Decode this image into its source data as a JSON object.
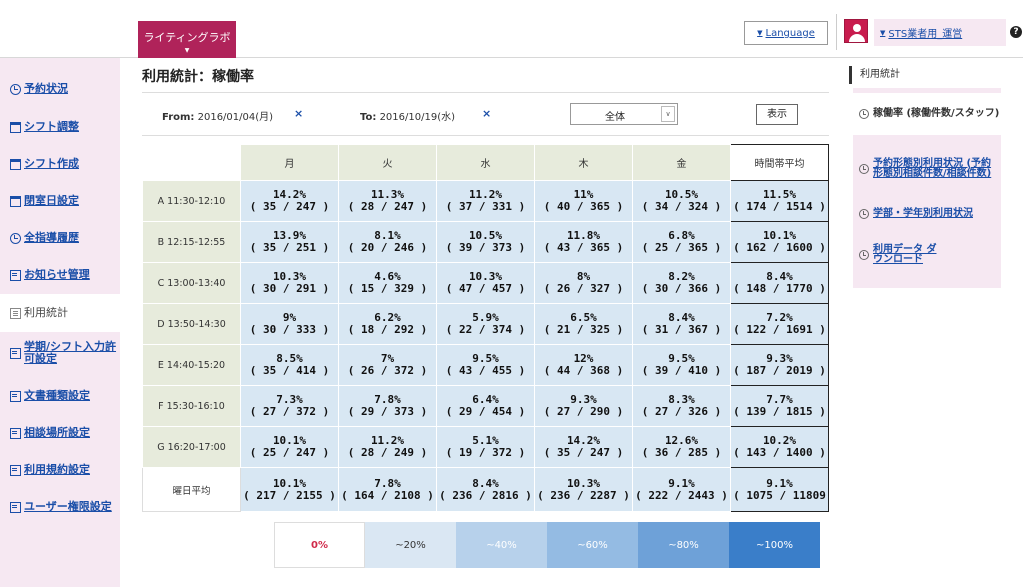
{
  "header": {
    "brand_label": "ライティングラボ",
    "language_label": "Language",
    "user_label": "STS業者用_運営",
    "help_label": "?"
  },
  "sidebar": {
    "items": [
      {
        "label": "予約状況",
        "icon": "clock-icon"
      },
      {
        "label": "シフト調整",
        "icon": "calendar-icon"
      },
      {
        "label": "シフト作成",
        "icon": "calendar-icon"
      },
      {
        "label": "閉室日設定",
        "icon": "calendar-icon"
      },
      {
        "label": "全指導履歴",
        "icon": "clock-icon"
      },
      {
        "label": "お知らせ管理",
        "icon": "document-icon"
      },
      {
        "label": "利用統計",
        "icon": "list-icon",
        "active": true
      },
      {
        "label": "学期/シフト入力許可設定",
        "icon": "document-icon"
      },
      {
        "label": "文書種類設定",
        "icon": "document-icon"
      },
      {
        "label": "相談場所設定",
        "icon": "document-icon"
      },
      {
        "label": "利用規約設定",
        "icon": "document-icon"
      },
      {
        "label": "ユーザー権限設定",
        "icon": "document-icon"
      }
    ]
  },
  "main": {
    "title": "利用統計：稼働率",
    "from_label": "From:",
    "from_value": "2016/01/04(月)",
    "to_label": "To:",
    "to_value": "2016/10/19(水)",
    "clear_glyph": "×",
    "select_value": "全体",
    "show_button": "表示"
  },
  "table": {
    "day_headers": [
      "月",
      "火",
      "水",
      "木",
      "金"
    ],
    "avg_header": "時間帯平均",
    "day_avg_label": "曜日平均",
    "rows": [
      {
        "slot": "A 11:30-12:10",
        "cells": [
          [
            "14.2%",
            "( 35 / 247 )"
          ],
          [
            "11.3%",
            "( 28 / 247 )"
          ],
          [
            "11.2%",
            "( 37 / 331 )"
          ],
          [
            "11%",
            "( 40 / 365 )"
          ],
          [
            "10.5%",
            "( 34 / 324 )"
          ]
        ],
        "avg": [
          "11.5%",
          "( 174 / 1514 )"
        ]
      },
      {
        "slot": "B 12:15-12:55",
        "cells": [
          [
            "13.9%",
            "( 35 / 251 )"
          ],
          [
            "8.1%",
            "( 20 / 246 )"
          ],
          [
            "10.5%",
            "( 39 / 373 )"
          ],
          [
            "11.8%",
            "( 43 / 365 )"
          ],
          [
            "6.8%",
            "( 25 / 365 )"
          ]
        ],
        "avg": [
          "10.1%",
          "( 162 / 1600 )"
        ]
      },
      {
        "slot": "C 13:00-13:40",
        "cells": [
          [
            "10.3%",
            "( 30 / 291 )"
          ],
          [
            "4.6%",
            "( 15 / 329 )"
          ],
          [
            "10.3%",
            "( 47 / 457 )"
          ],
          [
            "8%",
            "( 26 / 327 )"
          ],
          [
            "8.2%",
            "( 30 / 366 )"
          ]
        ],
        "avg": [
          "8.4%",
          "( 148 / 1770 )"
        ]
      },
      {
        "slot": "D 13:50-14:30",
        "cells": [
          [
            "9%",
            "( 30 / 333 )"
          ],
          [
            "6.2%",
            "( 18 / 292 )"
          ],
          [
            "5.9%",
            "( 22 / 374 )"
          ],
          [
            "6.5%",
            "( 21 / 325 )"
          ],
          [
            "8.4%",
            "( 31 / 367 )"
          ]
        ],
        "avg": [
          "7.2%",
          "( 122 / 1691 )"
        ]
      },
      {
        "slot": "E 14:40-15:20",
        "cells": [
          [
            "8.5%",
            "( 35 / 414 )"
          ],
          [
            "7%",
            "( 26 / 372 )"
          ],
          [
            "9.5%",
            "( 43 / 455 )"
          ],
          [
            "12%",
            "( 44 / 368 )"
          ],
          [
            "9.5%",
            "( 39 / 410 )"
          ]
        ],
        "avg": [
          "9.3%",
          "( 187 / 2019 )"
        ]
      },
      {
        "slot": "F 15:30-16:10",
        "cells": [
          [
            "7.3%",
            "( 27 / 372 )"
          ],
          [
            "7.8%",
            "( 29 / 373 )"
          ],
          [
            "6.4%",
            "( 29 / 454 )"
          ],
          [
            "9.3%",
            "( 27 / 290 )"
          ],
          [
            "8.3%",
            "( 27 / 326 )"
          ]
        ],
        "avg": [
          "7.7%",
          "( 139 / 1815 )"
        ]
      },
      {
        "slot": "G 16:20-17:00",
        "cells": [
          [
            "10.1%",
            "( 25 / 247 )"
          ],
          [
            "11.2%",
            "( 28 / 249 )"
          ],
          [
            "5.1%",
            "( 19 / 372 )"
          ],
          [
            "14.2%",
            "( 35 / 247 )"
          ],
          [
            "12.6%",
            "( 36 / 285 )"
          ]
        ],
        "avg": [
          "10.2%",
          "( 143 / 1400 )"
        ]
      }
    ],
    "day_avgs": [
      [
        "10.1%",
        "( 217 / 2155 )"
      ],
      [
        "7.8%",
        "( 164 / 2108 )"
      ],
      [
        "8.4%",
        "( 236 / 2816 )"
      ],
      [
        "10.3%",
        "( 236 / 2287 )"
      ],
      [
        "9.1%",
        "( 222 / 2443 )"
      ]
    ],
    "total_avg": [
      "9.1%",
      "( 1075 / 11809"
    ]
  },
  "legend": [
    "0%",
    "~20%",
    "~40%",
    "~60%",
    "~80%",
    "~100%"
  ],
  "right_panel": {
    "title": "利用統計",
    "items": [
      {
        "label": "稼働率 (稼働件数/スタッフ)",
        "active": true
      },
      {
        "label": "予約形態別利用状況 (予約形態別相談件数/相談件数)"
      },
      {
        "label": "学部・学年別利用状況"
      },
      {
        "label": "利用データ ダウンロード"
      }
    ]
  },
  "colors": {
    "brand": "#b0235a",
    "link": "#1a4ea8",
    "sidebar_bg": "#f6e8f2",
    "cell_bg": "#d8e7f3",
    "header_bg": "#e7ebdc"
  }
}
